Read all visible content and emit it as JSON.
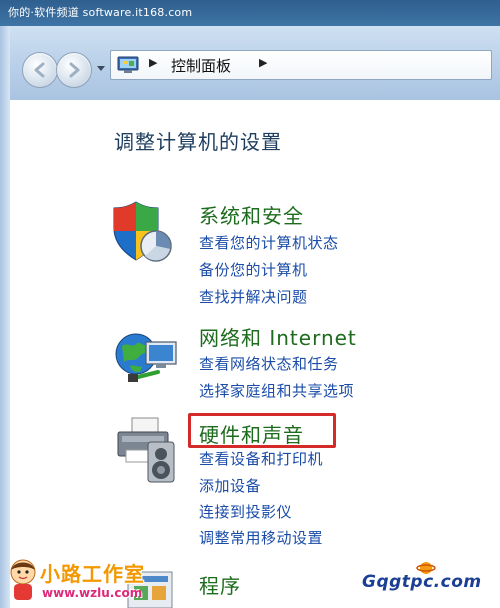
{
  "watermark_top": "你的·软件频道 software.it168.com",
  "address_bar": {
    "path_label": "控制面板"
  },
  "main": {
    "heading": "调整计算机的设置",
    "categories": [
      {
        "title": "系统和安全",
        "links": [
          "查看您的计算机状态",
          "备份您的计算机",
          "查找并解决问题"
        ]
      },
      {
        "title": "网络和 Internet",
        "links": [
          "查看网络状态和任务",
          "选择家庭组和共享选项"
        ]
      },
      {
        "title": "硬件和声音",
        "links": [
          "查看设备和打印机",
          "添加设备",
          "连接到投影仪",
          "调整常用移动设置"
        ]
      },
      {
        "title": "程序",
        "links": []
      }
    ]
  },
  "watermark_left": {
    "name": "小路工作室",
    "url": "www.wzlu.com"
  },
  "watermark_right": {
    "name": "Gqgtpc.com"
  },
  "colors": {
    "title_green": "#1d6b1d",
    "link_blue": "#1a4ca8",
    "highlight_red": "#d42a2a",
    "heading": "#1e3e5f"
  }
}
